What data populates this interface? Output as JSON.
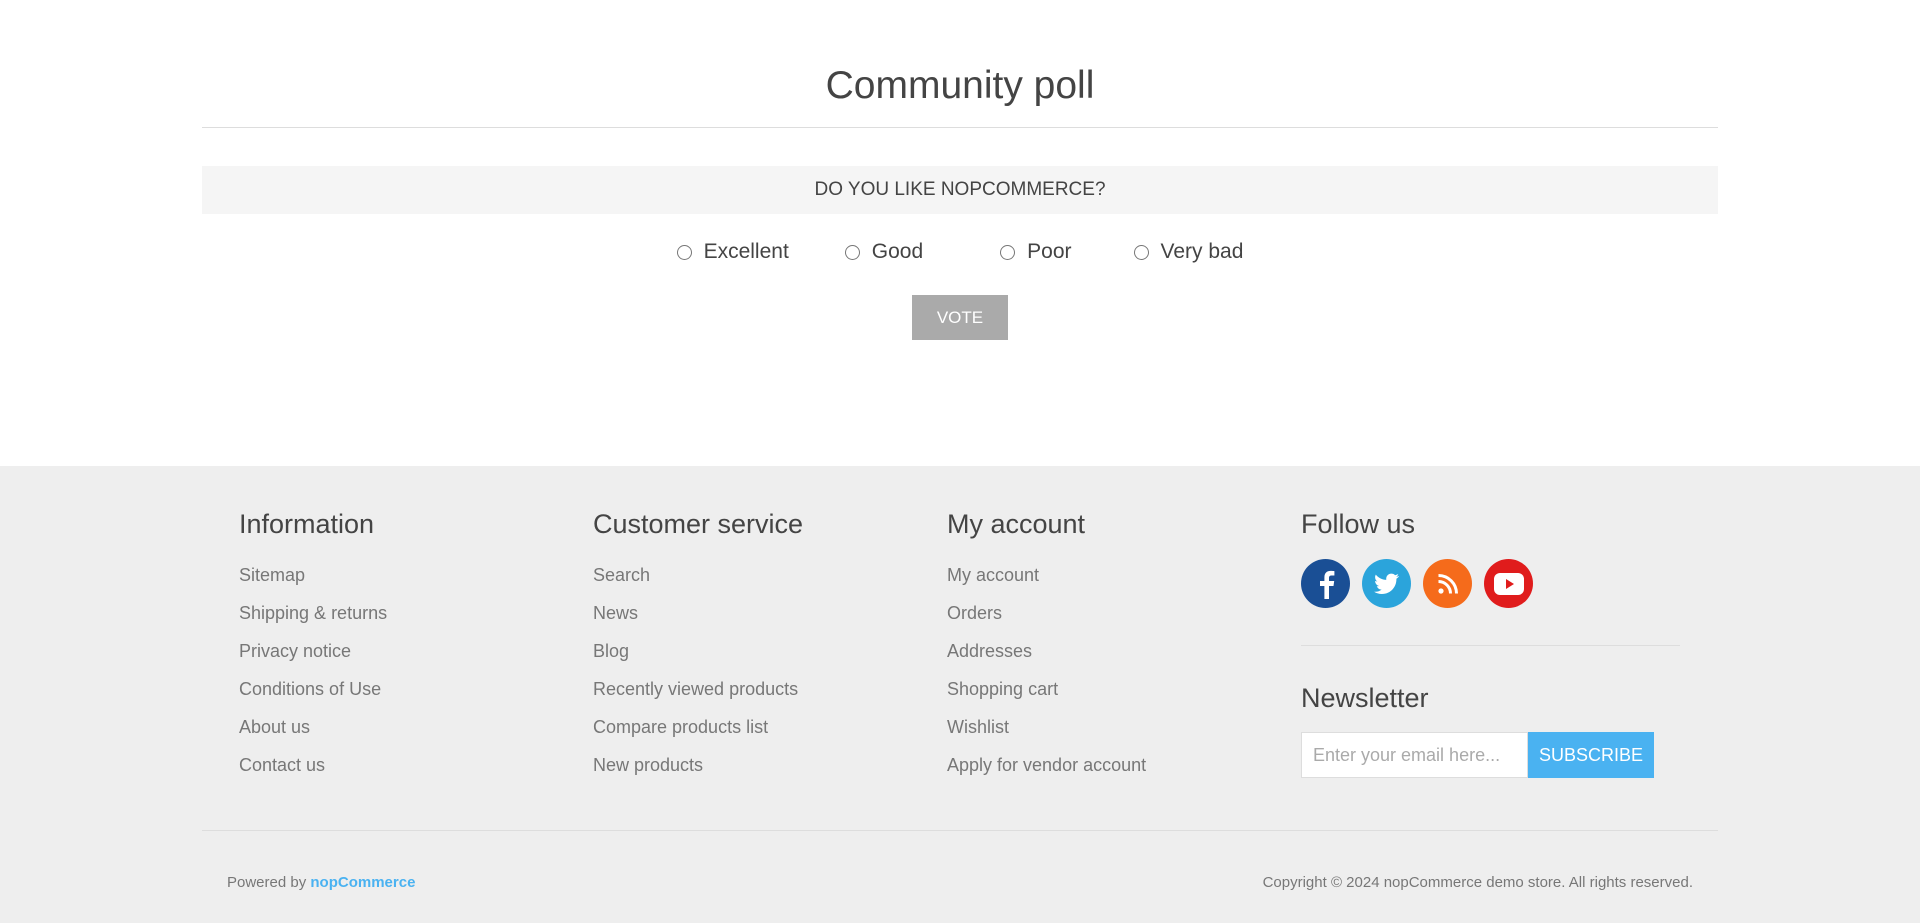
{
  "poll": {
    "title": "Community poll",
    "question": "DO YOU LIKE NOPCOMMERCE?",
    "answers": [
      "Excellent",
      "Good",
      "Poor",
      "Very bad"
    ],
    "vote_label": "VOTE"
  },
  "footer": {
    "information": {
      "title": "Information",
      "links": [
        "Sitemap",
        "Shipping & returns",
        "Privacy notice",
        "Conditions of Use",
        "About us",
        "Contact us"
      ]
    },
    "customer_service": {
      "title": "Customer service",
      "links": [
        "Search",
        "News",
        "Blog",
        "Recently viewed products",
        "Compare products list",
        "New products"
      ]
    },
    "my_account": {
      "title": "My account",
      "links": [
        "My account",
        "Orders",
        "Addresses",
        "Shopping cart",
        "Wishlist",
        "Apply for vendor account"
      ]
    },
    "follow_us": {
      "title": "Follow us",
      "icons": [
        "facebook-icon",
        "twitter-icon",
        "rss-icon",
        "youtube-icon"
      ],
      "colors": {
        "facebook": "#1a4f95",
        "twitter": "#2ba4db",
        "rss": "#f56b1b",
        "youtube": "#e01c1c"
      }
    },
    "newsletter": {
      "title": "Newsletter",
      "placeholder": "Enter your email here...",
      "subscribe_label": "SUBSCRIBE"
    },
    "powered_by_prefix": "Powered by ",
    "powered_by_link": "nopCommerce",
    "copyright": "Copyright © 2024 nopCommerce demo store. All rights reserved."
  },
  "colors": {
    "accent": "#4ab2f1",
    "vote_button": "#aaaaaa",
    "footer_background": "#eeeeee"
  }
}
